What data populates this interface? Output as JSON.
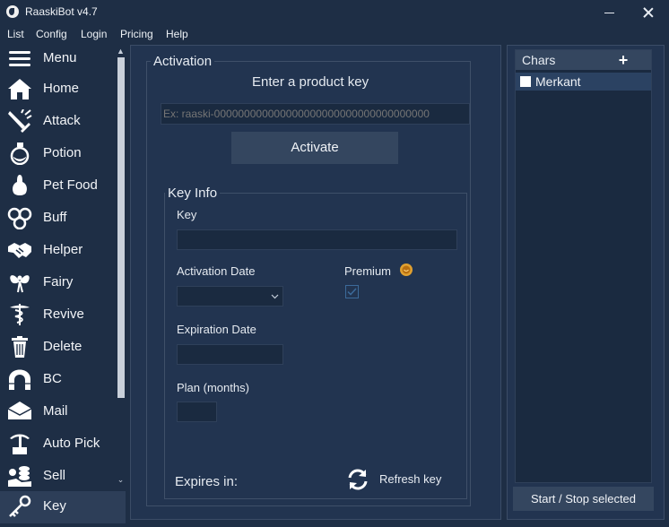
{
  "window": {
    "title": "RaaskiBot v4.7"
  },
  "menubar": [
    "List",
    "Config",
    "Login",
    "Pricing",
    "Help"
  ],
  "sidebar": {
    "items": [
      {
        "label": "Menu",
        "icon": "menu-icon"
      },
      {
        "label": "Home",
        "icon": "home-icon"
      },
      {
        "label": "Attack",
        "icon": "attack-icon"
      },
      {
        "label": "Potion",
        "icon": "potion-icon"
      },
      {
        "label": "Pet Food",
        "icon": "pet-food-icon"
      },
      {
        "label": "Buff",
        "icon": "buff-icon"
      },
      {
        "label": "Helper",
        "icon": "helper-icon"
      },
      {
        "label": "Fairy",
        "icon": "fairy-icon"
      },
      {
        "label": "Revive",
        "icon": "revive-icon"
      },
      {
        "label": "Delete",
        "icon": "delete-icon"
      },
      {
        "label": "BC",
        "icon": "bc-icon"
      },
      {
        "label": "Mail",
        "icon": "mail-icon"
      },
      {
        "label": "Auto Pick",
        "icon": "auto-pick-icon"
      },
      {
        "label": "Sell",
        "icon": "sell-icon"
      },
      {
        "label": "Key",
        "icon": "key-icon",
        "selected": true
      }
    ]
  },
  "activation": {
    "group_title": "Activation",
    "heading": "Enter a product key",
    "key_placeholder": "Ex: raaski-000000000000000000000000000000000000",
    "activate_label": "Activate"
  },
  "key_info": {
    "group_title": "Key Info",
    "key_label": "Key",
    "key_value": "",
    "activation_date_label": "Activation Date",
    "activation_date_value": "",
    "premium_label": "Premium",
    "premium_checked": true,
    "expiration_date_label": "Expiration Date",
    "expiration_date_value": "",
    "plan_label": "Plan (months)",
    "plan_value": "",
    "expires_label": "Expires in:",
    "refresh_label": "Refresh key"
  },
  "chars": {
    "header": "Chars",
    "add_label": "+",
    "items": [
      {
        "name": "Merkant",
        "checked": false
      }
    ],
    "start_stop_label": "Start / Stop selected"
  },
  "colors": {
    "background": "#1e2e45",
    "panel": "#223450",
    "field": "#1a2a40",
    "button": "#34465f",
    "selected_row": "#2b4262",
    "text": "#e8edf3",
    "premium_badge": "#e0a030"
  }
}
